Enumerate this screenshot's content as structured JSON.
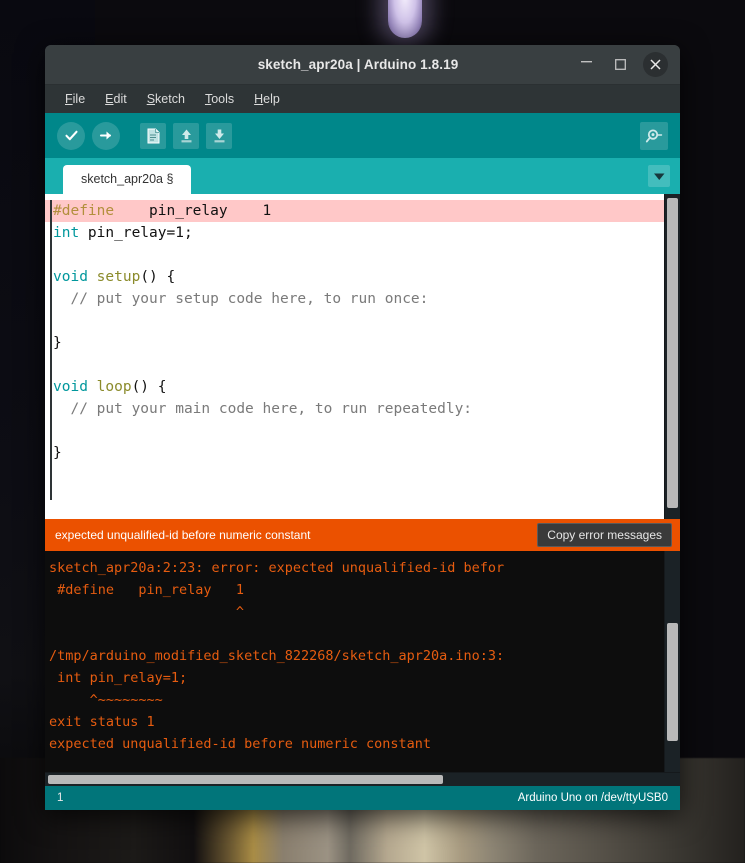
{
  "window": {
    "title": "sketch_apr20a | Arduino 1.8.19",
    "minimize_label": "–",
    "maximize_label": "□",
    "close_label": "✕"
  },
  "menubar": {
    "items": [
      {
        "mnemonic": "F",
        "rest": "ile"
      },
      {
        "mnemonic": "E",
        "rest": "dit"
      },
      {
        "mnemonic": "S",
        "rest": "ketch"
      },
      {
        "mnemonic": "T",
        "rest": "ools"
      },
      {
        "mnemonic": "H",
        "rest": "elp"
      }
    ]
  },
  "toolbar": {
    "verify": "verify-icon",
    "upload": "upload-icon",
    "new": "new-sketch-icon",
    "open": "open-sketch-icon",
    "save": "save-sketch-icon",
    "serial_monitor": "serial-monitor-icon"
  },
  "tabbar": {
    "tab_label": "sketch_apr20a §",
    "dropdown": "chevron-down-icon"
  },
  "editor": {
    "lines": [
      {
        "highlighted": true,
        "tokens": [
          {
            "cls": "pre",
            "t": "#define"
          },
          {
            "cls": "punct",
            "t": "    pin_relay    1"
          }
        ]
      },
      {
        "highlighted": false,
        "tokens": [
          {
            "cls": "kw",
            "t": "int"
          },
          {
            "cls": "punct",
            "t": " pin_relay=1;"
          }
        ]
      },
      {
        "highlighted": false,
        "tokens": []
      },
      {
        "highlighted": false,
        "tokens": [
          {
            "cls": "kw",
            "t": "void"
          },
          {
            "cls": "punct",
            "t": " "
          },
          {
            "cls": "fn",
            "t": "setup"
          },
          {
            "cls": "punct",
            "t": "() {"
          }
        ]
      },
      {
        "highlighted": false,
        "tokens": [
          {
            "cls": "cmt",
            "t": "  // put your setup code here, to run once:"
          }
        ]
      },
      {
        "highlighted": false,
        "tokens": []
      },
      {
        "highlighted": false,
        "tokens": [
          {
            "cls": "punct",
            "t": "}"
          }
        ]
      },
      {
        "highlighted": false,
        "tokens": []
      },
      {
        "highlighted": false,
        "tokens": [
          {
            "cls": "kw",
            "t": "void"
          },
          {
            "cls": "punct",
            "t": " "
          },
          {
            "cls": "fn",
            "t": "loop"
          },
          {
            "cls": "punct",
            "t": "() {"
          }
        ]
      },
      {
        "highlighted": false,
        "tokens": [
          {
            "cls": "cmt",
            "t": "  // put your main code here, to run repeatedly:"
          }
        ]
      },
      {
        "highlighted": false,
        "tokens": []
      },
      {
        "highlighted": false,
        "tokens": [
          {
            "cls": "punct",
            "t": "}"
          }
        ]
      }
    ]
  },
  "error_strip": {
    "message": "expected unqualified-id before numeric constant",
    "copy_button": "Copy error messages"
  },
  "console": {
    "lines": [
      "sketch_apr20a:2:23: error: expected unqualified-id befor",
      " #define   pin_relay   1",
      "                       ^",
      "",
      "/tmp/arduino_modified_sketch_822268/sketch_apr20a.ino:3:",
      " int pin_relay=1;",
      "     ^~~~~~~~~",
      "exit status 1",
      "expected unqualified-id before numeric constant"
    ]
  },
  "statusbar": {
    "line_number": "1",
    "board_info": "Arduino Uno on /dev/ttyUSB0"
  }
}
